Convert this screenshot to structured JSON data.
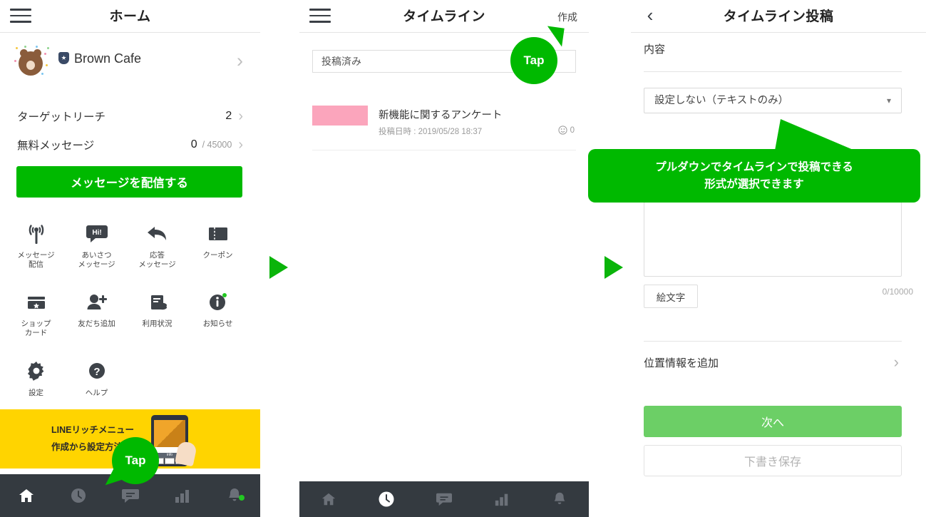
{
  "panel1": {
    "header": {
      "title": "ホーム",
      "menu_icon": "hamburger-menu-icon"
    },
    "profile": {
      "name": "Brown Cafe",
      "badge_icon": "shield-badge-icon",
      "avatar_icon": "brown-bear-avatar"
    },
    "stats": [
      {
        "label": "ターゲットリーチ",
        "value": "2",
        "sub": ""
      },
      {
        "label": "無料メッセージ",
        "value": "0",
        "sub": "/ 45000"
      }
    ],
    "cta": "メッセージを配信する",
    "grid": [
      {
        "icon": "broadcast-icon",
        "label": "メッセージ\n配信"
      },
      {
        "icon": "greeting-bubble-icon",
        "label": "あいさつ\nメッセージ"
      },
      {
        "icon": "reply-arrow-icon",
        "label": "応答\nメッセージ"
      },
      {
        "icon": "coupon-ticket-icon",
        "label": "クーポン"
      },
      {
        "icon": "shop-card-icon",
        "label": "ショップ\nカード"
      },
      {
        "icon": "add-friend-icon",
        "label": "友だち追加"
      },
      {
        "icon": "usage-stats-icon",
        "label": "利用状況"
      },
      {
        "icon": "info-notice-icon",
        "label": "お知らせ"
      },
      {
        "icon": "gear-settings-icon",
        "label": "設定"
      },
      {
        "icon": "question-help-icon",
        "label": "ヘルプ"
      }
    ],
    "banner": {
      "line1": "LINEリッチメニュー",
      "line2": "作成から設定方法"
    },
    "nav": [
      {
        "icon": "home-icon",
        "active": true
      },
      {
        "icon": "clock-icon",
        "active": false
      },
      {
        "icon": "chat-bubble-icon",
        "active": false
      },
      {
        "icon": "bar-chart-icon",
        "active": false
      },
      {
        "icon": "bell-icon",
        "active": false,
        "dot": true
      }
    ],
    "tap_label": "Tap"
  },
  "panel2": {
    "header": {
      "title": "タイムライン",
      "action": "作成",
      "menu_icon": "hamburger-menu-icon"
    },
    "filter_value": "投稿済み",
    "post": {
      "title": "新機能に関するアンケート",
      "meta": "投稿日時 : 2019/05/28 18:37",
      "reaction_icon": "smiley-reaction-icon",
      "reaction_count": "0"
    },
    "nav": [
      {
        "icon": "home-icon",
        "active": false
      },
      {
        "icon": "clock-icon",
        "active": true
      },
      {
        "icon": "chat-bubble-icon",
        "active": false
      },
      {
        "icon": "bar-chart-icon",
        "active": false
      },
      {
        "icon": "bell-icon",
        "active": false
      }
    ],
    "tap_label": "Tap"
  },
  "panel3": {
    "header": {
      "title": "タイムライン投稿",
      "back_icon": "back-chevron-icon"
    },
    "content_label": "内容",
    "format_select": {
      "value": "設定しない（テキストのみ）",
      "caret_icon": "chevron-down-icon"
    },
    "textarea_value": "",
    "emoji_button": "絵文字",
    "counter": "0/10000",
    "location_row": {
      "label": "位置情報を追加",
      "chevron_icon": "chevron-right-icon"
    },
    "next_button": "次へ",
    "draft_button": "下書き保存"
  },
  "annotations": {
    "callout_line1": "プルダウンでタイムラインで投稿できる",
    "callout_line2": "形式が選択できます",
    "play_icon": "play-triangle-icon"
  },
  "colors": {
    "line_green": "#00b900",
    "next_green": "#6ccf66",
    "banner_yellow": "#ffd400",
    "nav_dark": "#343a40",
    "thumb_pink": "#fba5bc"
  }
}
